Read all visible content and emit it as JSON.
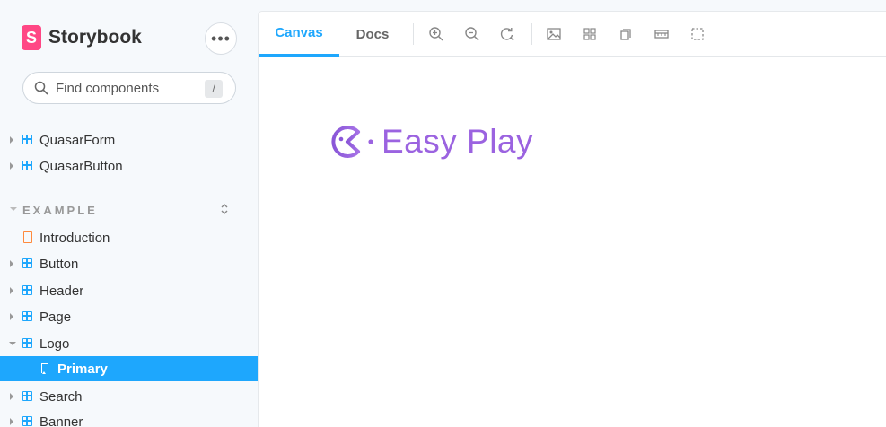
{
  "brand": {
    "name": "Storybook",
    "logo_letter": "S",
    "menu_glyph": "•••"
  },
  "search": {
    "placeholder": "Find components",
    "shortcut": "/"
  },
  "tree": {
    "top_items": [
      {
        "label": "QuasarForm"
      },
      {
        "label": "QuasarButton"
      }
    ],
    "section": {
      "label": "EXAMPLE"
    },
    "items": [
      {
        "label": "Introduction",
        "type": "doc"
      },
      {
        "label": "Button",
        "type": "component"
      },
      {
        "label": "Header",
        "type": "component"
      },
      {
        "label": "Page",
        "type": "component"
      },
      {
        "label": "Logo",
        "type": "component",
        "expanded": true
      },
      {
        "label": "Primary",
        "type": "story",
        "selected": true
      },
      {
        "label": "Search",
        "type": "component"
      },
      {
        "label": "Banner",
        "type": "component"
      }
    ]
  },
  "toolbar": {
    "tabs": [
      {
        "label": "Canvas",
        "active": true
      },
      {
        "label": "Docs",
        "active": false
      }
    ],
    "tools": [
      "zoom-in-icon",
      "zoom-out-icon",
      "zoom-reset-icon",
      "background-icon",
      "grid-icon",
      "viewport-icon",
      "measure-icon",
      "outline-icon"
    ]
  },
  "canvas": {
    "logo_text": "Easy Play",
    "logo_color": "#9b63e0"
  },
  "colors": {
    "accent": "#1ea7fd",
    "brand": "#ff4785"
  }
}
